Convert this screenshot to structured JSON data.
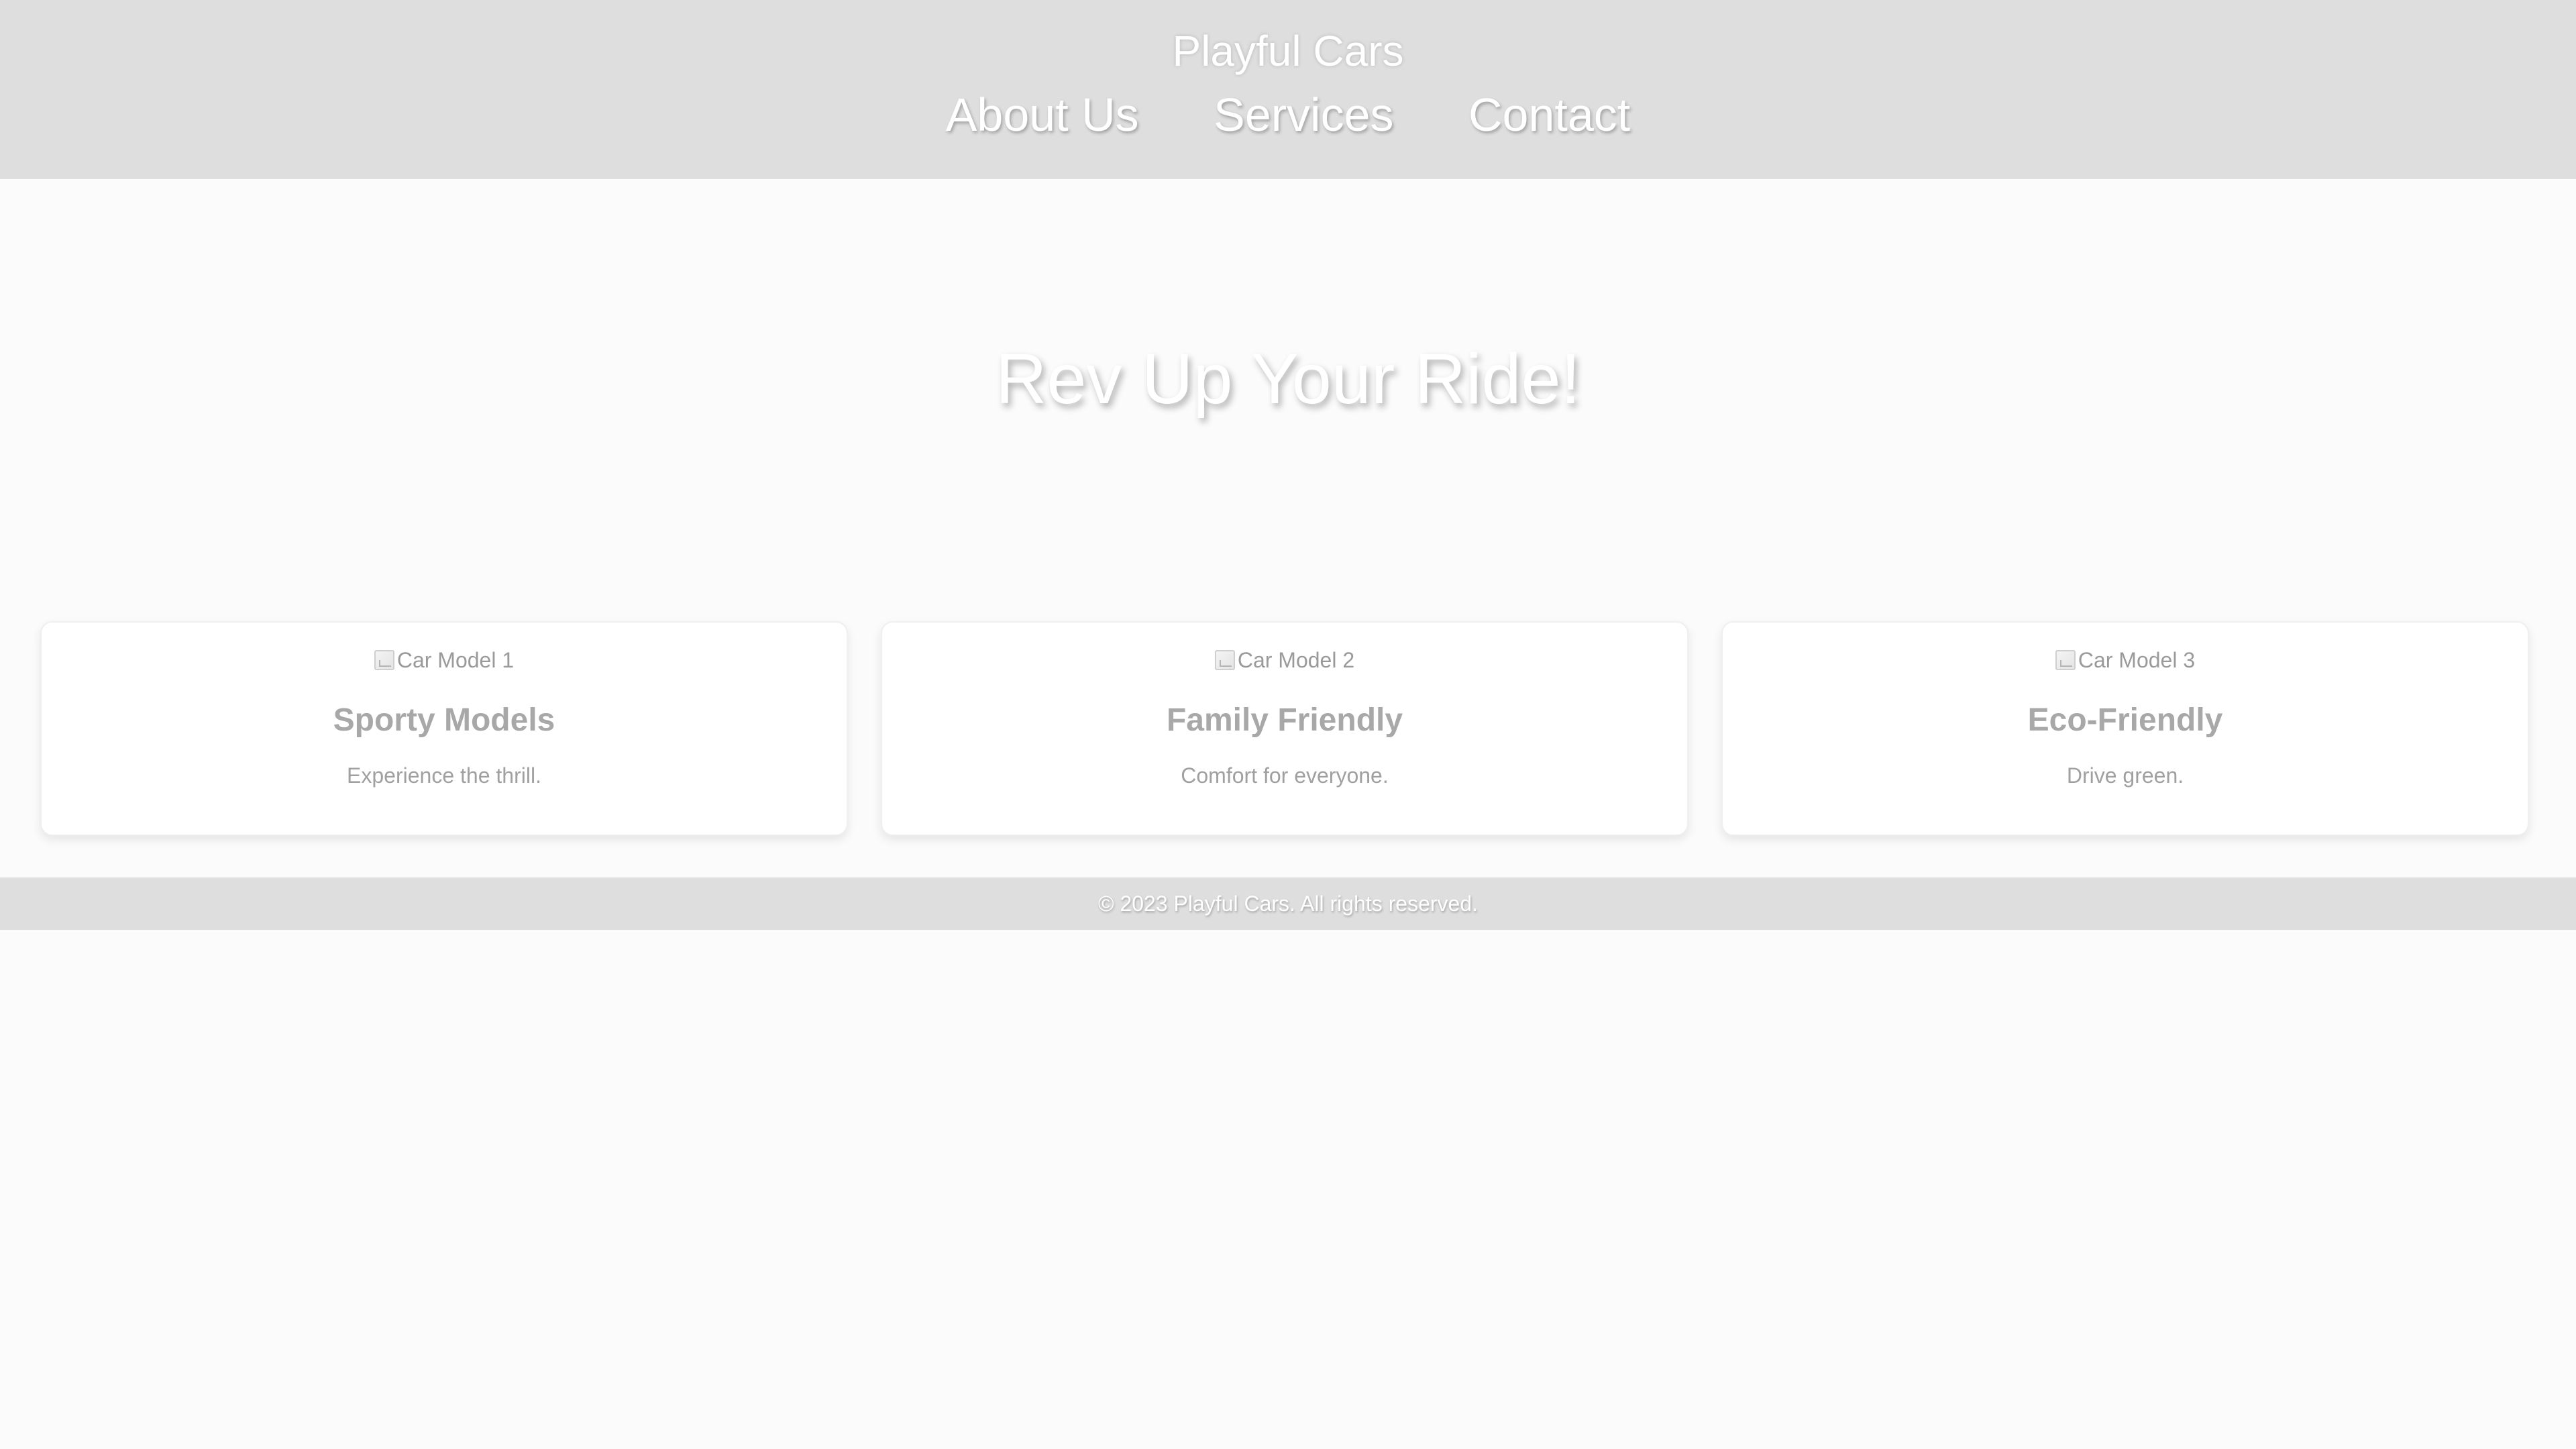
{
  "header": {
    "site_title": "Playful Cars",
    "nav": [
      {
        "label": "About Us"
      },
      {
        "label": "Services"
      },
      {
        "label": "Contact"
      }
    ]
  },
  "hero": {
    "title": "Rev Up Your Ride!"
  },
  "cards": [
    {
      "image_alt": "Car Model 1",
      "title": "Sporty Models",
      "description": "Experience the thrill."
    },
    {
      "image_alt": "Car Model 2",
      "title": "Family Friendly",
      "description": "Comfort for everyone."
    },
    {
      "image_alt": "Car Model 3",
      "title": "Eco-Friendly",
      "description": "Drive green."
    }
  ],
  "footer": {
    "text": "© 2023 Playful Cars. All rights reserved."
  },
  "colors": {
    "header_bg": "#dedede",
    "page_bg": "#fbfbfb",
    "card_bg": "#ffffff",
    "text_light": "#ffffff",
    "text_gray": "#a8a8a8"
  }
}
